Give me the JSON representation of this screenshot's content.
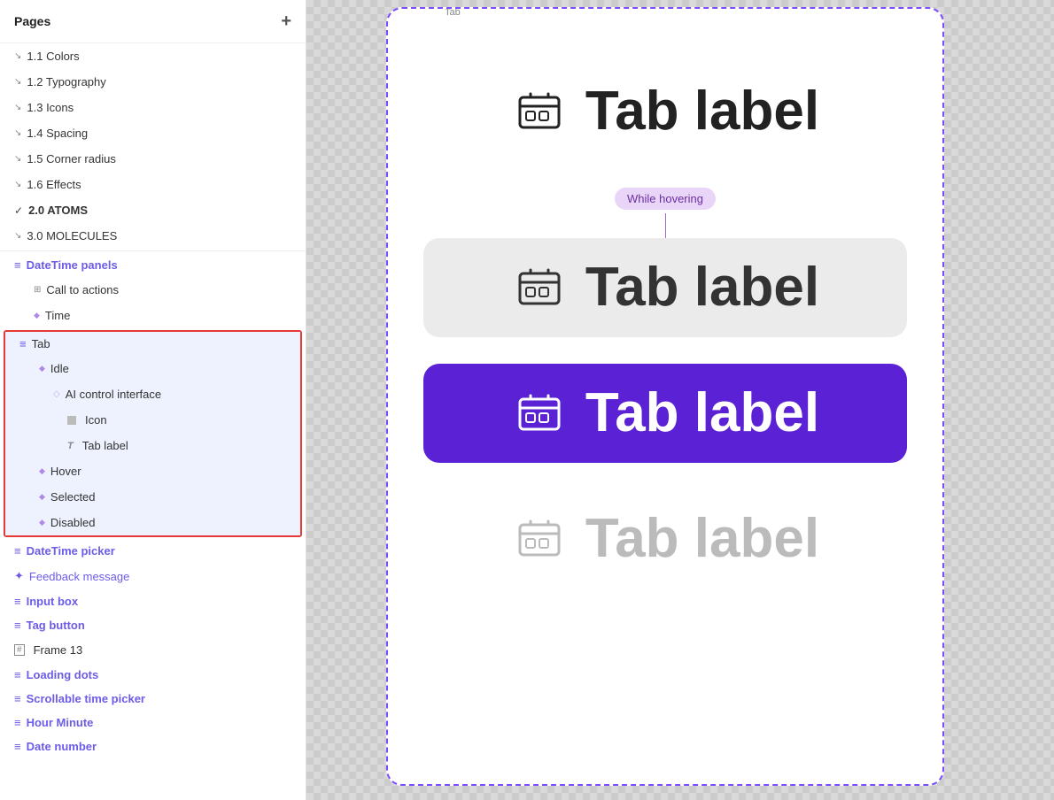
{
  "sidebar": {
    "header_title": "Pages",
    "plus_icon": "+",
    "pages": [
      {
        "id": "colors",
        "label": "1.1 Colors",
        "icon": "arrow",
        "indent": 0
      },
      {
        "id": "typography",
        "label": "1.2 Typography",
        "icon": "arrow",
        "indent": 0
      },
      {
        "id": "icons",
        "label": "1.3 Icons",
        "icon": "arrow",
        "indent": 0
      },
      {
        "id": "spacing",
        "label": "1.4 Spacing",
        "icon": "arrow",
        "indent": 0
      },
      {
        "id": "corner-radius",
        "label": "1.5 Corner radius",
        "icon": "arrow",
        "indent": 0
      },
      {
        "id": "effects",
        "label": "1.6 Effects",
        "icon": "arrow",
        "indent": 0
      },
      {
        "id": "atoms",
        "label": "2.0 ATOMS",
        "icon": "check",
        "indent": 0
      },
      {
        "id": "molecules",
        "label": "3.0 MOLECULES",
        "icon": "arrow",
        "indent": 0
      }
    ],
    "tree_items": [
      {
        "id": "datetime-panels",
        "label": "DateTime panels",
        "icon": "lines",
        "indent": 0,
        "type": "section"
      },
      {
        "id": "call-to-actions",
        "label": "Call to actions",
        "icon": "grid",
        "indent": 1,
        "type": "item"
      },
      {
        "id": "time",
        "label": "Time",
        "icon": "diamond",
        "indent": 1,
        "type": "item"
      },
      {
        "id": "tab",
        "label": "Tab",
        "icon": "lines",
        "indent": 0,
        "type": "section",
        "selected": true
      },
      {
        "id": "idle",
        "label": "Idle",
        "icon": "diamond",
        "indent": 1,
        "type": "item"
      },
      {
        "id": "ai-control",
        "label": "AI control interface",
        "icon": "diamond-outline",
        "indent": 2,
        "type": "item"
      },
      {
        "id": "icon",
        "label": "Icon",
        "icon": "rect",
        "indent": 3,
        "type": "item"
      },
      {
        "id": "tab-label",
        "label": "Tab label",
        "icon": "text-t",
        "indent": 3,
        "type": "item"
      },
      {
        "id": "hover",
        "label": "Hover",
        "icon": "diamond",
        "indent": 1,
        "type": "item"
      },
      {
        "id": "selected",
        "label": "Selected",
        "icon": "diamond",
        "indent": 1,
        "type": "item"
      },
      {
        "id": "disabled",
        "label": "Disabled",
        "icon": "diamond",
        "indent": 1,
        "type": "item"
      },
      {
        "id": "datetime-picker",
        "label": "DateTime picker",
        "icon": "lines",
        "indent": 0,
        "type": "section"
      },
      {
        "id": "feedback-message",
        "label": "Feedback message",
        "icon": "cross",
        "indent": 0,
        "type": "item"
      },
      {
        "id": "input-box",
        "label": "Input box",
        "icon": "lines",
        "indent": 0,
        "type": "section"
      },
      {
        "id": "tag-button",
        "label": "Tag button",
        "icon": "lines",
        "indent": 0,
        "type": "section"
      },
      {
        "id": "frame-13",
        "label": "Frame 13",
        "icon": "frame",
        "indent": 0,
        "type": "item"
      },
      {
        "id": "loading-dots",
        "label": "Loading dots",
        "icon": "lines",
        "indent": 0,
        "type": "section"
      },
      {
        "id": "scrollable-time-picker",
        "label": "Scrollable time picker",
        "icon": "lines",
        "indent": 0,
        "type": "section"
      },
      {
        "id": "hour-minute",
        "label": "Hour Minute",
        "icon": "lines",
        "indent": 0,
        "type": "section"
      },
      {
        "id": "date-number",
        "label": "Date number",
        "icon": "lines",
        "indent": 0,
        "type": "section"
      }
    ]
  },
  "canvas": {
    "frame_top_label": "Tab",
    "tab_variants": [
      {
        "id": "idle",
        "label": "Tab label",
        "state": "idle"
      },
      {
        "id": "hover",
        "label": "Tab label",
        "state": "hover",
        "tooltip": "While hovering"
      },
      {
        "id": "selected",
        "label": "Tab label",
        "state": "selected"
      },
      {
        "id": "disabled",
        "label": "Tab label",
        "state": "disabled"
      }
    ]
  }
}
